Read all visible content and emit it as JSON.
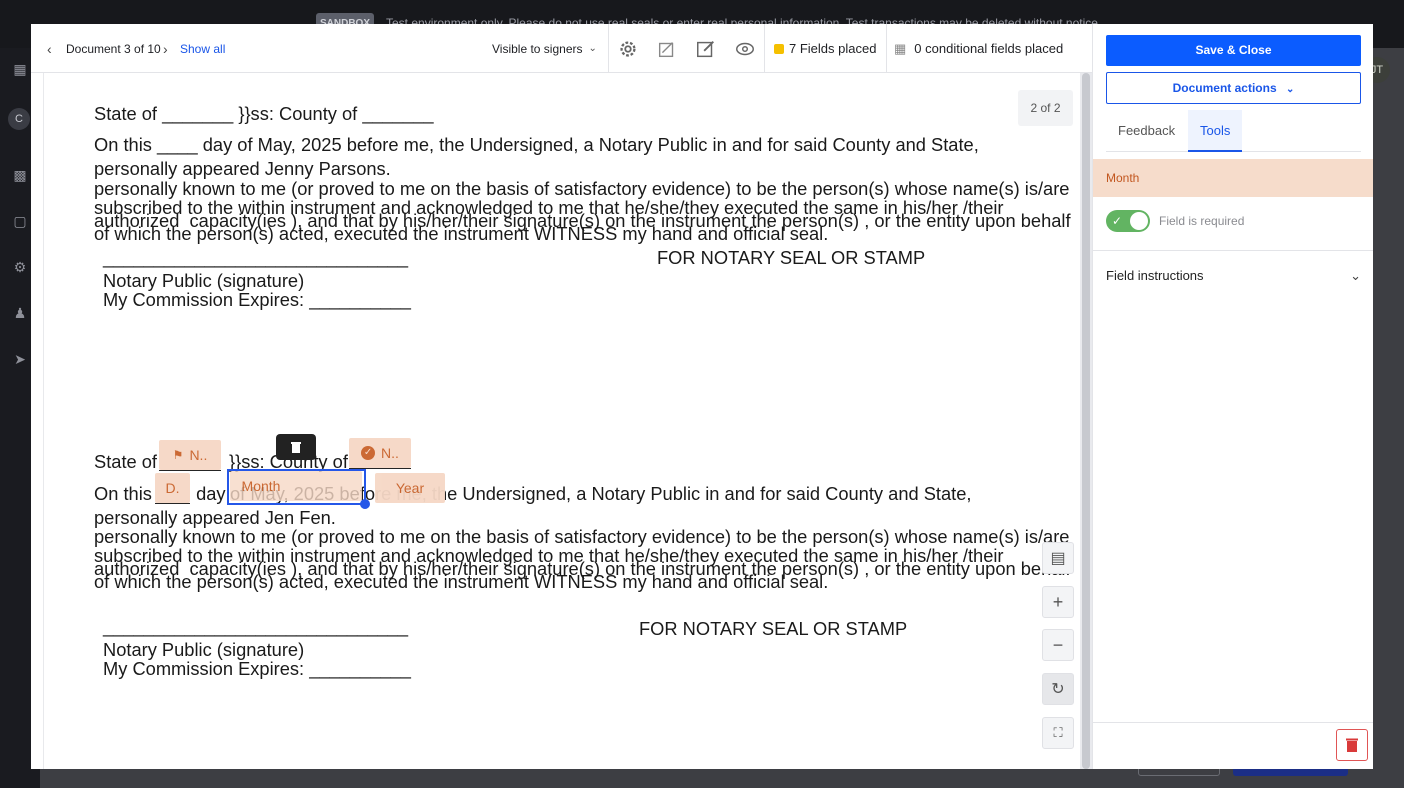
{
  "background": {
    "banner_tag": "SANDBOX",
    "banner_text": "Test environment only. Please do not use real seals or enter real personal information. Test transactions may be deleted without notice.",
    "avatar_left": "C",
    "avatar_right": "JT"
  },
  "toolbar": {
    "doc_counter": "Document 3 of 10",
    "show_all": "Show all",
    "visibility": "Visible to signers",
    "fields_placed": "7 Fields placed",
    "conditional_fields": "0 conditional fields placed",
    "fields_dot_color": "#f5c000"
  },
  "document": {
    "page_indicator": "2 of 2",
    "block1": {
      "state_line": "State of _______ }}ss: County of _______",
      "line1": "On this ____ day of May, 2025 before me, the Undersigned, a Notary Public in and for said County and State,",
      "line2": "personally appeared Jenny Parsons.",
      "line3": "personally known to me (or proved to me on the basis of satisfactory evidence) to be the person(s) whose name(s) is/are",
      "line4": "subscribed to the within instrument and acknowledged to me that he/she/they executed the same in his/her /their",
      "line5": "authorized  capacity(ies ), and that by his/her/their signature(s) on the instrument the person(s) , or the entity upon behalf",
      "line6": "of which the person(s) acted, executed the instrument WITNESS my hand and official seal.",
      "sig_line": "______________________________",
      "seal": "FOR NOTARY SEAL OR STAMP",
      "notary": "Notary Public (signature)",
      "expires": "My Commission Expires: __________"
    },
    "block2": {
      "state_prefix": "State of ",
      "state_mid": "}}ss: County of",
      "line1_prefix": "On this ",
      "line1_mid": " day ",
      "line1_rest": "of May, 2025 before me, the Undersigned, a Notary Public in and for said County and State,",
      "line2": "personally appeared Jen Fen.",
      "line3": "personally known to me (or proved to me on the basis of satisfactory evidence) to be the person(s) whose name(s) is/are",
      "line4": "subscribed to the within instrument and acknowledged to me that he/she/they executed the same in his/her /their",
      "line5": "authorized  capacity(ies ), and that by his/her/their signature(s) on the instrument the person(s) , or the entity upon behalf",
      "line6": "of which the person(s) acted, executed the instrument WITNESS my hand and official seal.",
      "sig_line": "______________________________",
      "seal": "FOR NOTARY SEAL OR STAMP",
      "notary": "Notary Public (signature)",
      "expires": "My Commission Expires: __________"
    },
    "fields": {
      "state_chip": "N..",
      "county_chip": "N..",
      "day_chip": "D.",
      "month_chip": "Month",
      "year_chip": "Year"
    }
  },
  "panel": {
    "save_close": "Save & Close",
    "document_actions": "Document actions",
    "tab_feedback": "Feedback",
    "tab_tools": "Tools",
    "field_type": "Month",
    "field_required": "Field is required",
    "field_instructions": "Field instructions"
  }
}
